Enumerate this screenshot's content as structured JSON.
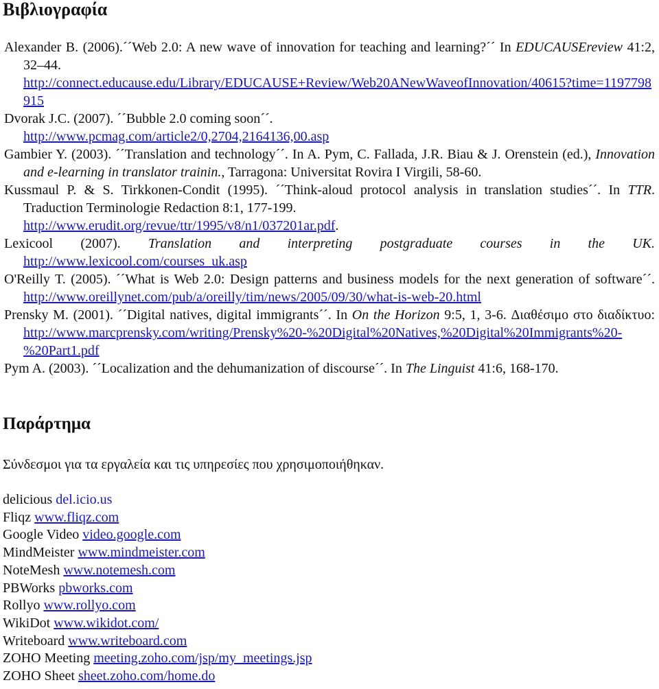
{
  "bibliography": {
    "heading": "Βιβλιογραφία",
    "entries": [
      {
        "pre": "Alexander B. (2006).´´Web 2.0: A new wave of innovation for teaching and learning?´´ In ",
        "italic": "EDUCAUSEreview",
        "post": " 41:2, 32–44.",
        "url": "http://connect.educause.edu/Library/EDUCAUSE+Review/Web20ANewWaveofInnovation/40615?time=1197798915"
      },
      {
        "pre": "Dvorak J.C. (2007). ´´Bubble 2.0 coming soon´´.",
        "url": "http://www.pcmag.com/article2/0,2704,2164136,00.asp"
      },
      {
        "pre": "Gambier Y. (2003). ´´Translation and technology´´. In A. Pym, C. Fallada, J.R. Biau & J. Orenstein (ed.), ",
        "italic": "Innovation and e-learning in translator trainin.",
        "post": ", Tarragona: Universitat Rovira I Virgili, 58-60."
      },
      {
        "pre": "Kussmaul P. & S. Tirkkonen-Condit (1995). ´´Think-aloud protocol analysis in translation studies´´. In ",
        "italic": "TTR",
        "post": ". Traduction Terminologie Redaction 8:1, 177-199.",
        "url": "http://www.erudit.org/revue/ttr/1995/v8/n1/037201ar.pdf",
        "url_suffix": "."
      },
      {
        "pre": "Lexicool (2007). ",
        "italic": "Translation and interpreting postgraduate courses in the UK.",
        "url": "http://www.lexicool.com/courses_uk.asp"
      },
      {
        "pre": "O'Reilly T. (2005). ´´What is Web 2.0: Design patterns and business models for the next generation of software´´. ",
        "url": "http://www.oreillynet.com/pub/a/oreilly/tim/news/2005/09/30/what-is-web-20.html"
      },
      {
        "pre": "Prensky M. (2001). ´´Digital natives, digital immigrants´´. In ",
        "italic": "On the Horizon",
        "post": " 9:5, 1, 3-6. Διαθέσιμο στο διαδίκτυο: ",
        "url": "http://www.marcprensky.com/writing/Prensky%20-%20Digital%20Natives,%20Digital%20Immigrants%20-%20Part1.pdf"
      },
      {
        "pre": "Pym A. (2003). ´´Localization and the dehumanization of discourse´´. In ",
        "italic": "The Linguist",
        "post": " 41:6, 168-170."
      }
    ]
  },
  "appendix": {
    "heading": "Παράρτημα",
    "intro": "Σύνδεσμοι για τα εργαλεία και τις υπηρεσίες που χρησιμοποιήθηκαν.",
    "tools": [
      {
        "name": "delicious",
        "link": "del.icio.us",
        "underlined": false
      },
      {
        "name": "Fliqz",
        "link": "www.fliqz.com",
        "underlined": true
      },
      {
        "name": "Google Video",
        "link": "video.google.com",
        "underlined": true
      },
      {
        "name": "MindMeister",
        "link": "www.mindmeister.com",
        "underlined": true
      },
      {
        "name": "NoteMesh",
        "link": "www.notemesh.com",
        "underlined": true
      },
      {
        "name": "PBWorks",
        "link": "pbworks.com",
        "underlined": true
      },
      {
        "name": "Rollyo",
        "link": "www.rollyo.com",
        "underlined": true
      },
      {
        "name": "WikiDot",
        "link": "www.wikidot.com/",
        "underlined": true
      },
      {
        "name": "Writeboard",
        "link": "www.writeboard.com",
        "underlined": true
      },
      {
        "name": "ZOHO Meeting",
        "link": "meeting.zoho.com/jsp/my_meetings.jsp",
        "underlined": true
      },
      {
        "name": "ZOHO Sheet",
        "link": "sheet.zoho.com/home.do",
        "underlined": true
      }
    ]
  },
  "colors": {
    "text": "#111111",
    "link": "#1a1ab0",
    "background": "#ffffff"
  }
}
